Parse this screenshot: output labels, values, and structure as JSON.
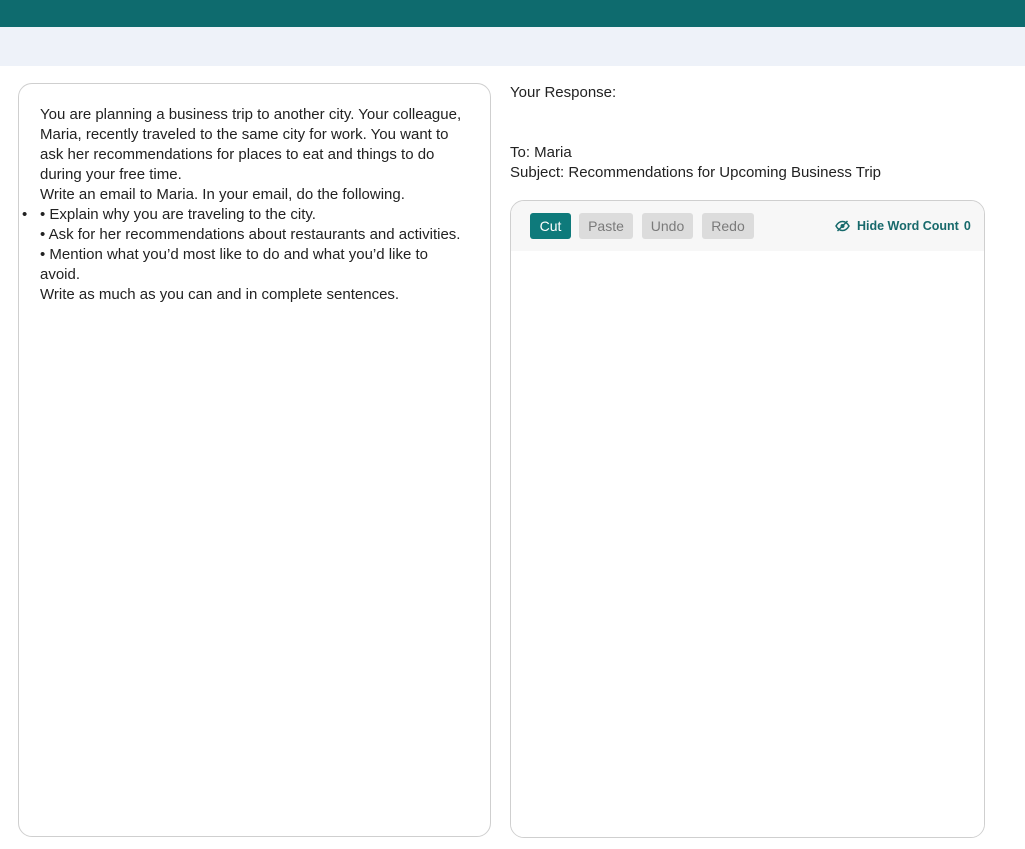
{
  "prompt": {
    "intro": "You are planning a business trip to another city. Your colleague, Maria, recently traveled to the same city for work. You want to ask her recommendations for places to eat and things to do during your free time.",
    "instruction": "Write an email to Maria. In your email, do the following.",
    "bullets": [
      "• Explain why you are traveling to the city.",
      "• Ask for her recommendations about restaurants and activities.",
      "• Mention what you’d most like to do and what you’d like to avoid."
    ],
    "closing": "Write as much as you can and in complete sentences."
  },
  "response": {
    "label": "Your Response:",
    "to_line": "To: Maria",
    "subject_line": "Subject: Recommendations for Upcoming Business Trip"
  },
  "editor": {
    "toolbar": {
      "cut_label": "Cut",
      "paste_label": "Paste",
      "undo_label": "Undo",
      "redo_label": "Redo",
      "word_count_toggle_label": "Hide Word Count",
      "word_count": "0",
      "eye_icon": "eye-slash-icon"
    },
    "text": ""
  },
  "colors": {
    "header": "#0e6b6e",
    "subheader": "#eef2f9",
    "accent": "#0e7a7b",
    "disabled_button": "#dcdcdc"
  }
}
